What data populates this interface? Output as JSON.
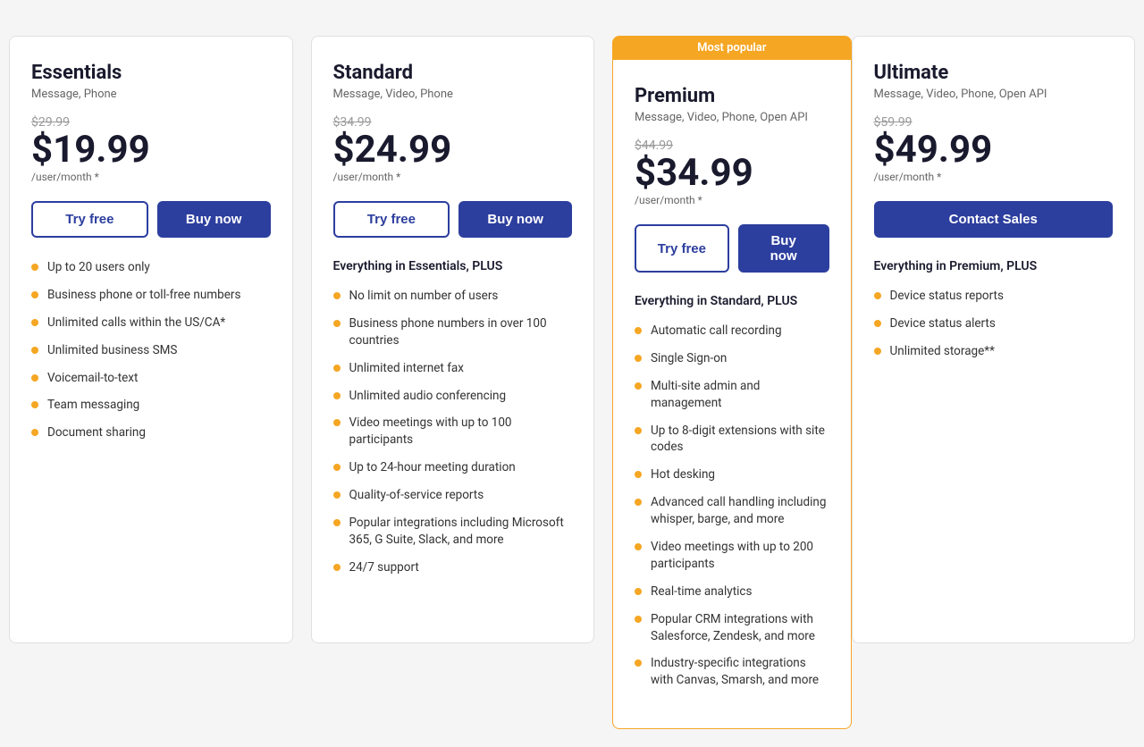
{
  "plans": [
    {
      "id": "essentials",
      "name": "Essentials",
      "subtitle": "Message, Phone",
      "original_price": "$29.99",
      "current_price": "$19.99",
      "price_note": "/user/month *",
      "btn_try": "Try free",
      "btn_buy": "Buy now",
      "features_header": null,
      "features": [
        "Up to 20 users only",
        "Business phone or toll-free numbers",
        "Unlimited calls within the US/CA*",
        "Unlimited business SMS",
        "Voicemail-to-text",
        "Team messaging",
        "Document sharing"
      ]
    },
    {
      "id": "standard",
      "name": "Standard",
      "subtitle": "Message, Video, Phone",
      "original_price": "$34.99",
      "current_price": "$24.99",
      "price_note": "/user/month *",
      "btn_try": "Try free",
      "btn_buy": "Buy now",
      "features_header": "Everything in Essentials, PLUS",
      "features": [
        "No limit on number of users",
        "Business phone numbers in over 100 countries",
        "Unlimited internet fax",
        "Unlimited audio conferencing",
        "Video meetings with up to 100 participants",
        "Up to 24-hour meeting duration",
        "Quality-of-service reports",
        "Popular integrations including Microsoft 365, G Suite, Slack, and more",
        "24/7 support"
      ]
    },
    {
      "id": "premium",
      "name": "Premium",
      "subtitle": "Message, Video, Phone, Open API",
      "original_price": "$44.99",
      "current_price": "$34.99",
      "price_note": "/user/month *",
      "btn_try": "Try free",
      "btn_buy": "Buy now",
      "most_popular": "Most popular",
      "features_header": "Everything in Standard, PLUS",
      "features": [
        "Automatic call recording",
        "Single Sign-on",
        "Multi-site admin and management",
        "Up to 8-digit extensions with site codes",
        "Hot desking",
        "Advanced call handling including whisper, barge, and more",
        "Video meetings with up to 200 participants",
        "Real-time analytics",
        "Popular CRM integrations with Salesforce, Zendesk, and more",
        "Industry-specific integrations with Canvas, Smarsh, and more"
      ]
    },
    {
      "id": "ultimate",
      "name": "Ultimate",
      "subtitle": "Message, Video, Phone, Open API",
      "original_price": "$59.99",
      "current_price": "$49.99",
      "price_note": "/user/month *",
      "btn_contact": "Contact Sales",
      "features_header": "Everything in Premium, PLUS",
      "features": [
        "Device status reports",
        "Device status alerts",
        "Unlimited storage**"
      ]
    }
  ]
}
